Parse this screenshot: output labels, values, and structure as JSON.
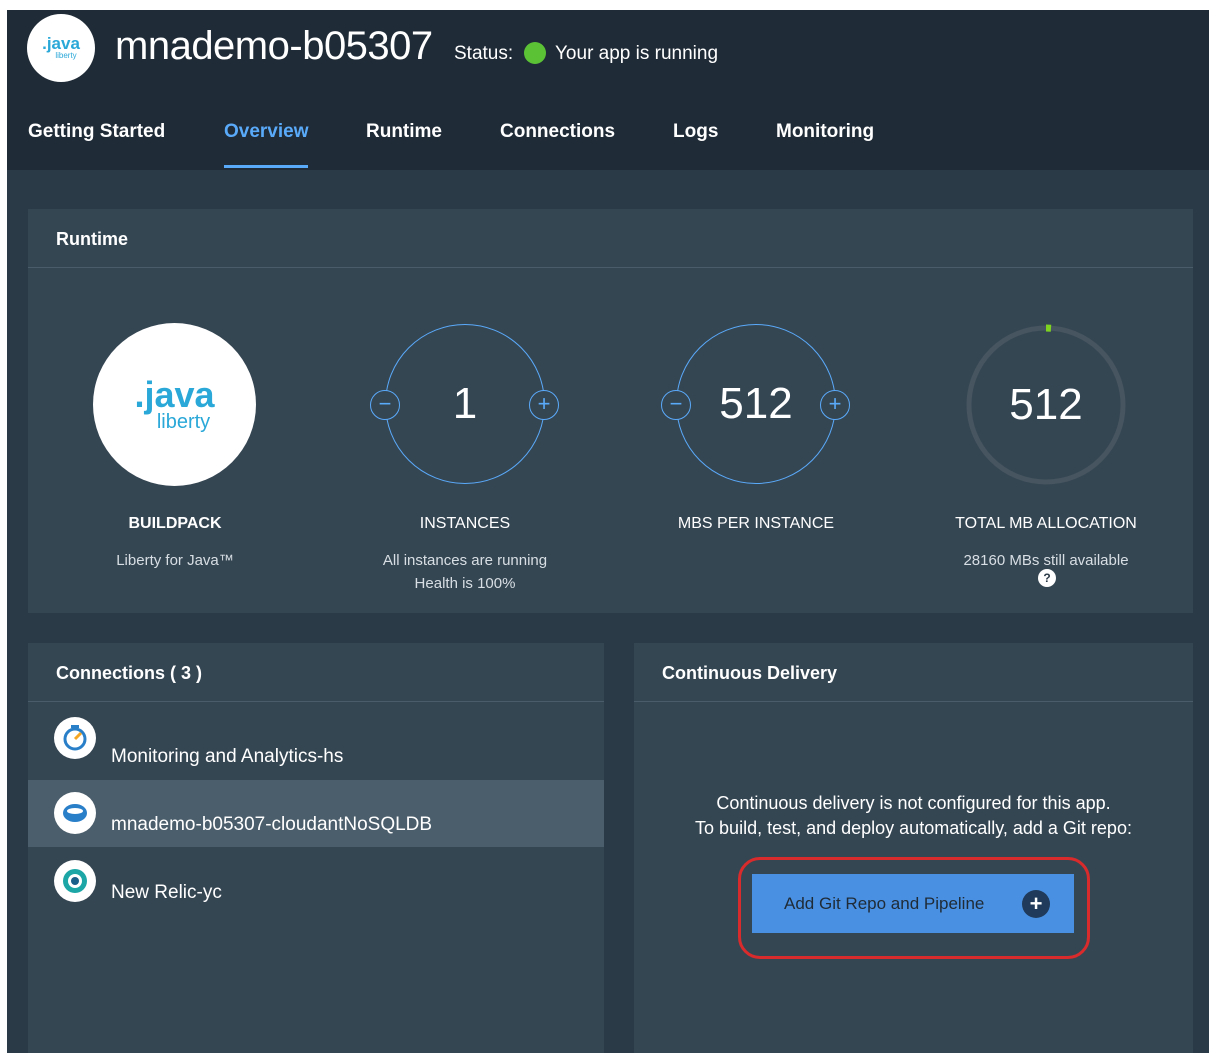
{
  "header": {
    "logo": {
      "line1": ".java",
      "line2": "liberty"
    },
    "app_name": "mnademo-b05307",
    "status_label": "Status:",
    "status_text": "Your app is running",
    "status_color": "#5bc236"
  },
  "tabs": [
    {
      "label": "Getting Started",
      "active": false
    },
    {
      "label": "Overview",
      "active": true
    },
    {
      "label": "Runtime",
      "active": false
    },
    {
      "label": "Connections",
      "active": false
    },
    {
      "label": "Logs",
      "active": false
    },
    {
      "label": "Monitoring",
      "active": false
    }
  ],
  "runtime": {
    "title": "Runtime",
    "buildpack": {
      "logo_line1": ".java",
      "logo_line2": "liberty",
      "label": "BUILDPACK",
      "value": "Liberty for Java™"
    },
    "instances": {
      "value": "1",
      "label": "INSTANCES",
      "sub1": "All instances are running",
      "sub2": "Health is 100%",
      "minus": "−",
      "plus": "+"
    },
    "mbs_per_instance": {
      "value": "512",
      "label": "MBS PER INSTANCE",
      "minus": "−",
      "plus": "+"
    },
    "total": {
      "value": "512",
      "label": "TOTAL MB ALLOCATION",
      "sub": "28160 MBs still available",
      "help": "?"
    }
  },
  "connections": {
    "title": "Connections ( 3 )",
    "items": [
      {
        "label": "Monitoring and Analytics-hs",
        "icon": "monitoring-icon",
        "selected": false
      },
      {
        "label": "mnademo-b05307-cloudantNoSQLDB",
        "icon": "cloudant-icon",
        "selected": true
      },
      {
        "label": "New Relic-yc",
        "icon": "new-relic-icon",
        "selected": false
      }
    ]
  },
  "continuous_delivery": {
    "title": "Continuous Delivery",
    "line1": "Continuous delivery is not configured for this app.",
    "line2": "To build, test, and deploy automatically, add a Git repo:",
    "button_label": "Add Git Repo and Pipeline",
    "button_plus": "+"
  },
  "colors": {
    "accent": "#5aaafa",
    "background": "#2b3a47",
    "panel": "#354653",
    "highlight": "#d92b2b"
  }
}
